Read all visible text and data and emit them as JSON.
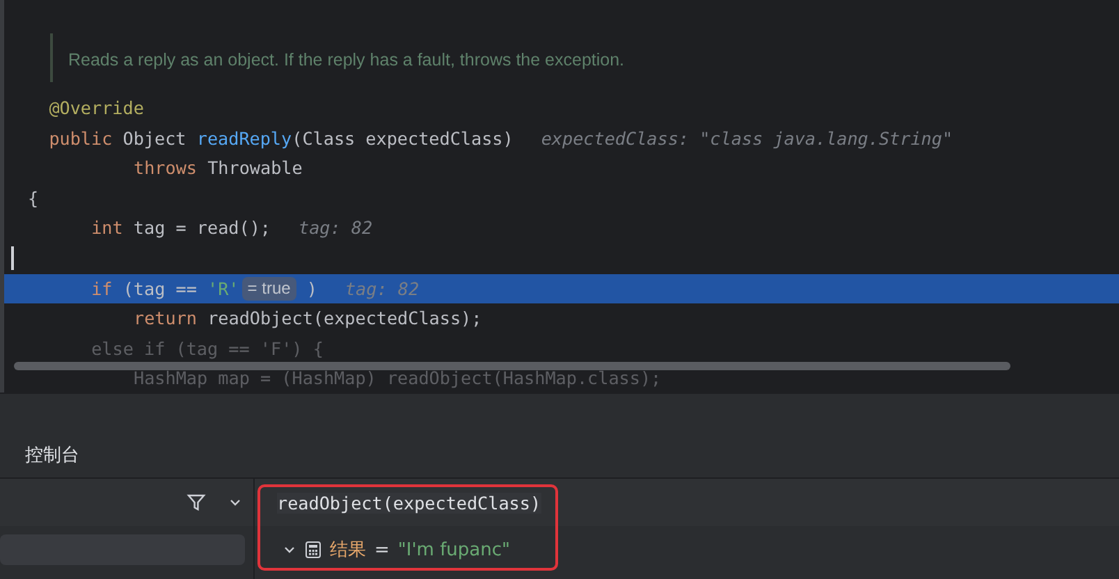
{
  "editor": {
    "doc_comment": "Reads a reply as an object. If the reply has a fault, throws the exception.",
    "lines": [
      {
        "kind": "member",
        "highlighted": false,
        "faded": false,
        "tokens": [
          {
            "kind": "annotation",
            "text": "@Override"
          }
        ]
      },
      {
        "kind": "member",
        "highlighted": false,
        "faded": false,
        "tokens": [
          {
            "kind": "keyword",
            "text": "public"
          },
          {
            "kind": "plain",
            "text": " Object "
          },
          {
            "kind": "method",
            "text": "readReply"
          },
          {
            "kind": "plain",
            "text": "(Class expectedClass)"
          },
          {
            "kind": "hint",
            "text": "expectedClass: \"class java.lang.String\""
          }
        ]
      },
      {
        "kind": "nested",
        "highlighted": false,
        "faded": false,
        "tokens": [
          {
            "kind": "keyword",
            "text": "throws"
          },
          {
            "kind": "plain",
            "text": " Throwable"
          }
        ]
      },
      {
        "kind": "top",
        "highlighted": false,
        "faded": false,
        "tokens": [
          {
            "kind": "plain",
            "text": "{"
          }
        ]
      },
      {
        "kind": "body",
        "highlighted": false,
        "faded": false,
        "tokens": [
          {
            "kind": "keyword",
            "text": "int"
          },
          {
            "kind": "plain",
            "text": " tag = read();"
          },
          {
            "kind": "hint",
            "text": "tag: 82"
          }
        ]
      },
      {
        "kind": "top",
        "highlighted": false,
        "faded": false,
        "caret": true
      },
      {
        "kind": "body",
        "highlighted": true,
        "faded": false,
        "tokens": [
          {
            "kind": "keyword",
            "text": "if"
          },
          {
            "kind": "plain",
            "text": " (tag == "
          },
          {
            "kind": "string",
            "text": "'R'"
          },
          {
            "kind": "badge",
            "text": "= true"
          },
          {
            "kind": "plain",
            "text": " )"
          },
          {
            "kind": "hint",
            "text": "tag: 82"
          }
        ]
      },
      {
        "kind": "nested",
        "highlighted": false,
        "faded": false,
        "tokens": [
          {
            "kind": "keyword",
            "text": "return"
          },
          {
            "kind": "plain",
            "text": " readObject(expectedClass);"
          }
        ]
      },
      {
        "kind": "body",
        "highlighted": false,
        "faded": true,
        "tokens": [
          {
            "kind": "plain",
            "text": "else if (tag == 'F') {"
          }
        ]
      },
      {
        "kind": "nested",
        "highlighted": false,
        "faded": true,
        "tokens": [
          {
            "kind": "plain",
            "text": "HashMap map = (HashMap) readObject(HashMap.class);"
          }
        ]
      }
    ]
  },
  "console": {
    "tab": "控制台",
    "expression": "readObject(expectedClass)",
    "result": {
      "expanded": true,
      "name": "结果",
      "equals": "=",
      "value": "\"I'm fupanc\""
    }
  }
}
